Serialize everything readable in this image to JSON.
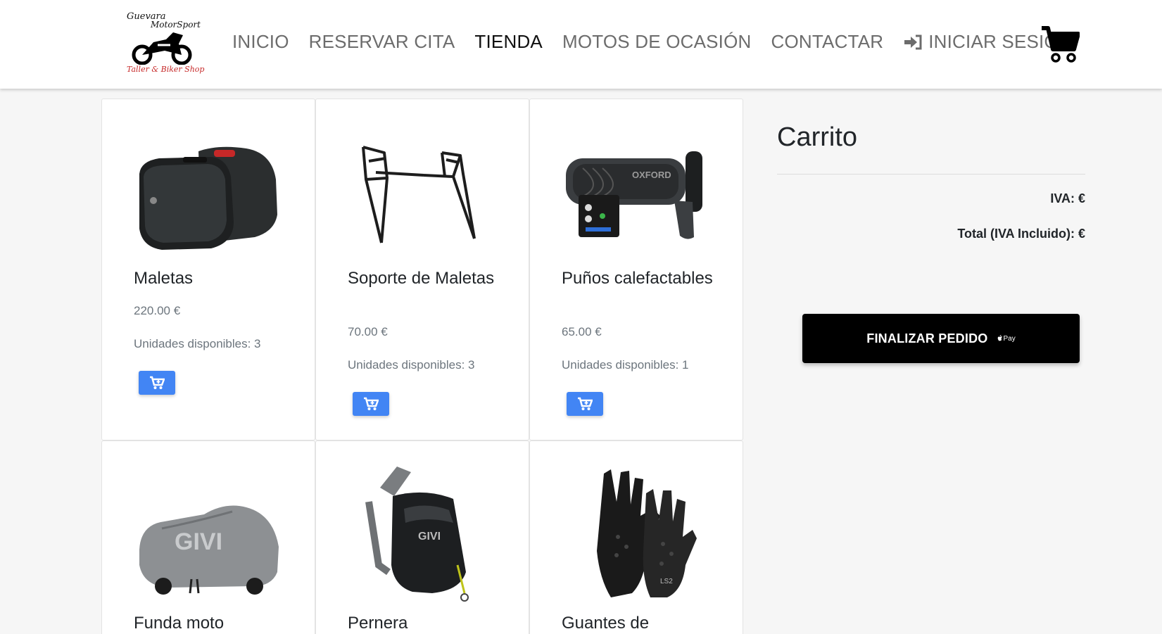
{
  "logo": {
    "line1": "Guevara",
    "line2": "MotorSport",
    "line3": "Taller & Biker Shop"
  },
  "nav": {
    "items": [
      {
        "label": "INICIO",
        "active": false
      },
      {
        "label": "RESERVAR CITA",
        "active": false
      },
      {
        "label": "TIENDA",
        "active": true
      },
      {
        "label": "MOTOS DE OCASIÓN",
        "active": false
      },
      {
        "label": "CONTACTAR",
        "active": false
      },
      {
        "label": "INICIAR SESIÓN",
        "active": false,
        "icon": "sign-in-icon"
      }
    ],
    "cart_icon": "shopping-cart-icon"
  },
  "products": [
    {
      "name": "Maletas",
      "price": "220.00 €",
      "stock": "Unidades disponibles: 3",
      "image": "side-cases-image"
    },
    {
      "name": "Soporte de Maletas",
      "price": "70.00 €",
      "stock": "Unidades disponibles: 3",
      "image": "case-rack-image"
    },
    {
      "name": "Puños calefactables",
      "price": "65.00 €",
      "stock": "Unidades disponibles: 1",
      "image": "heated-grips-image"
    },
    {
      "name": "Funda moto",
      "image": "bike-cover-image"
    },
    {
      "name": "Pernera",
      "image": "leg-bag-image"
    },
    {
      "name": "Guantes de",
      "image": "gloves-image"
    }
  ],
  "cart": {
    "title": "Carrito",
    "iva": "IVA: €",
    "total": "Total (IVA Incluido): €",
    "checkout_label": "FINALIZAR PEDIDO",
    "applepay_label": "Pay"
  },
  "colors": {
    "accent": "#4285f4",
    "nav_text": "#6c6c6c",
    "nav_active": "#111111",
    "checkout_bg": "#000000"
  }
}
